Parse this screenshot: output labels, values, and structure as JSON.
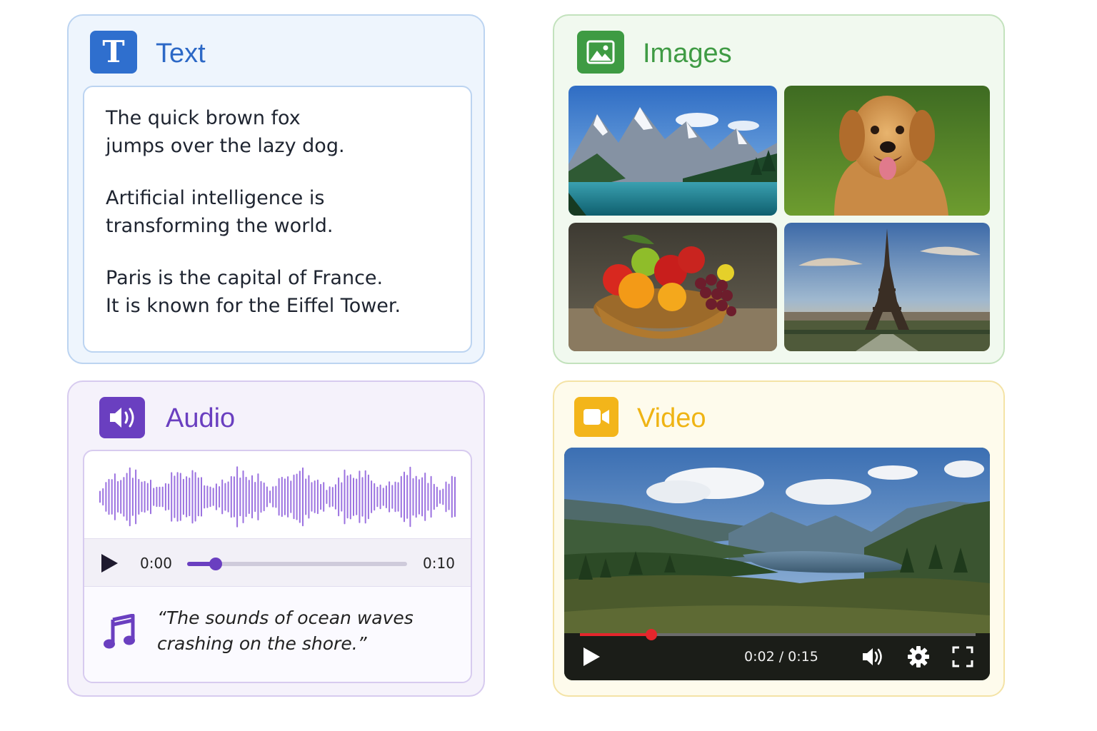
{
  "text_card": {
    "title": "Text",
    "badge_letter": "T",
    "paragraphs": [
      [
        "The quick brown fox",
        "jumps over the lazy dog."
      ],
      [
        "Artificial intelligence is",
        "transforming the world."
      ],
      [
        "Paris is the capital of France.",
        "It is known for the Eiffel Tower."
      ]
    ]
  },
  "images_card": {
    "title": "Images",
    "icon": "image-icon",
    "tiles": [
      "mountain-lake-image",
      "golden-retriever-image",
      "fruit-basket-image",
      "eiffel-tower-image"
    ]
  },
  "audio_card": {
    "title": "Audio",
    "icon": "speaker-icon",
    "current_time": "0:00",
    "total_time": "0:10",
    "progress": 0.13,
    "caption_lines": [
      "“The sounds of ocean waves",
      "crashing on the shore.”"
    ]
  },
  "video_card": {
    "title": "Video",
    "icon": "video-camera-icon",
    "time_display": "0:02 / 0:15",
    "progress": 0.18
  },
  "colors": {
    "text_accent": "#2f6fce",
    "images_accent": "#3e9b43",
    "audio_accent": "#6a3fc0",
    "video_accent": "#f3b51a",
    "video_progress": "#e4262c"
  }
}
